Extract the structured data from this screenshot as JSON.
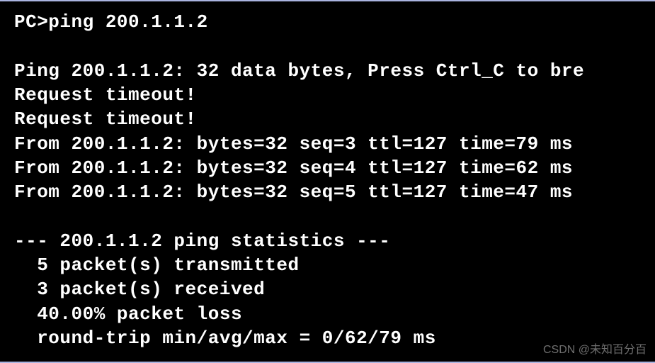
{
  "terminal": {
    "prompt_line": "PC>ping 200.1.1.2",
    "header_line": "Ping 200.1.1.2: 32 data bytes, Press Ctrl_C to bre",
    "timeout1": "Request timeout!",
    "timeout2": "Request timeout!",
    "reply1": "From 200.1.1.2: bytes=32 seq=3 ttl=127 time=79 ms",
    "reply2": "From 200.1.1.2: bytes=32 seq=4 ttl=127 time=62 ms",
    "reply3": "From 200.1.1.2: bytes=32 seq=5 ttl=127 time=47 ms",
    "stats_header": "--- 200.1.1.2 ping statistics ---",
    "stats_tx": "  5 packet(s) transmitted",
    "stats_rx": "  3 packet(s) received",
    "stats_loss": "  40.00% packet loss",
    "stats_rtt": "  round-trip min/avg/max = 0/62/79 ms"
  },
  "watermark": "CSDN @未知百分百"
}
